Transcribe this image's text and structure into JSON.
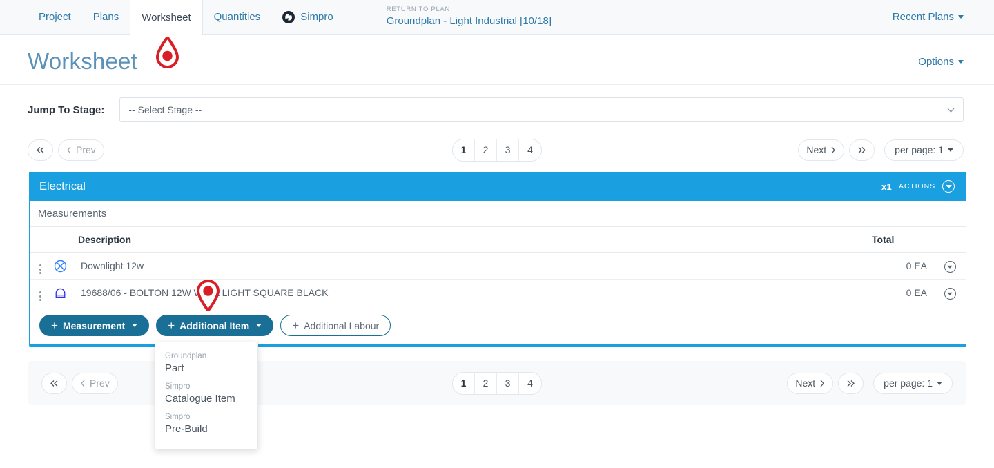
{
  "nav": {
    "items": [
      {
        "label": "Project",
        "active": false
      },
      {
        "label": "Plans",
        "active": false
      },
      {
        "label": "Worksheet",
        "active": true
      },
      {
        "label": "Quantities",
        "active": false
      },
      {
        "label": "Simpro",
        "active": false,
        "icon": "simpro-logo-icon"
      }
    ],
    "return": {
      "label": "RETURN TO PLAN",
      "title": "Groundplan - Light Industrial [10/18]"
    },
    "recent_plans": "Recent Plans"
  },
  "header": {
    "title": "Worksheet",
    "options": "Options"
  },
  "stage": {
    "label": "Jump To Stage:",
    "value": "-- Select Stage --"
  },
  "pagination_top": {
    "first": "«",
    "prev": "Prev",
    "pages": [
      "1",
      "2",
      "3",
      "4"
    ],
    "active_page": "1",
    "next": "Next",
    "last": "»",
    "per_page": "per page: 1"
  },
  "pagination_bottom": {
    "first": "«",
    "prev": "Prev",
    "pages": [
      "1",
      "2",
      "3",
      "4"
    ],
    "active_page": "1",
    "next": "Next",
    "last": "»",
    "per_page": "per page: 1"
  },
  "card": {
    "title": "Electrical",
    "quantity": "x1",
    "actions": "ACTIONS",
    "section_label": "Measurements",
    "columns": {
      "description": "Description",
      "total": "Total"
    },
    "rows": [
      {
        "icon": "circle-x-icon",
        "description": "Downlight 12w",
        "total": "0 EA"
      },
      {
        "icon": "dome-shape-icon",
        "description": "19688/06 - BOLTON 12W WALL LIGHT SQUARE BLACK",
        "total": "0 EA"
      }
    ],
    "buttons": {
      "measurement": "Measurement",
      "additional_item": "Additional Item",
      "additional_labour": "Additional Labour"
    }
  },
  "dropdown": {
    "entries": [
      {
        "group": "Groundplan",
        "label": "Part"
      },
      {
        "group": "Simpro",
        "label": "Catalogue Item"
      },
      {
        "group": "Simpro",
        "label": "Pre-Build"
      }
    ]
  },
  "colors": {
    "accent_blue": "#1aa0e0",
    "link_blue": "#2e7aa8",
    "button_blue": "#1a6f96",
    "marker_red": "#d81f26"
  }
}
